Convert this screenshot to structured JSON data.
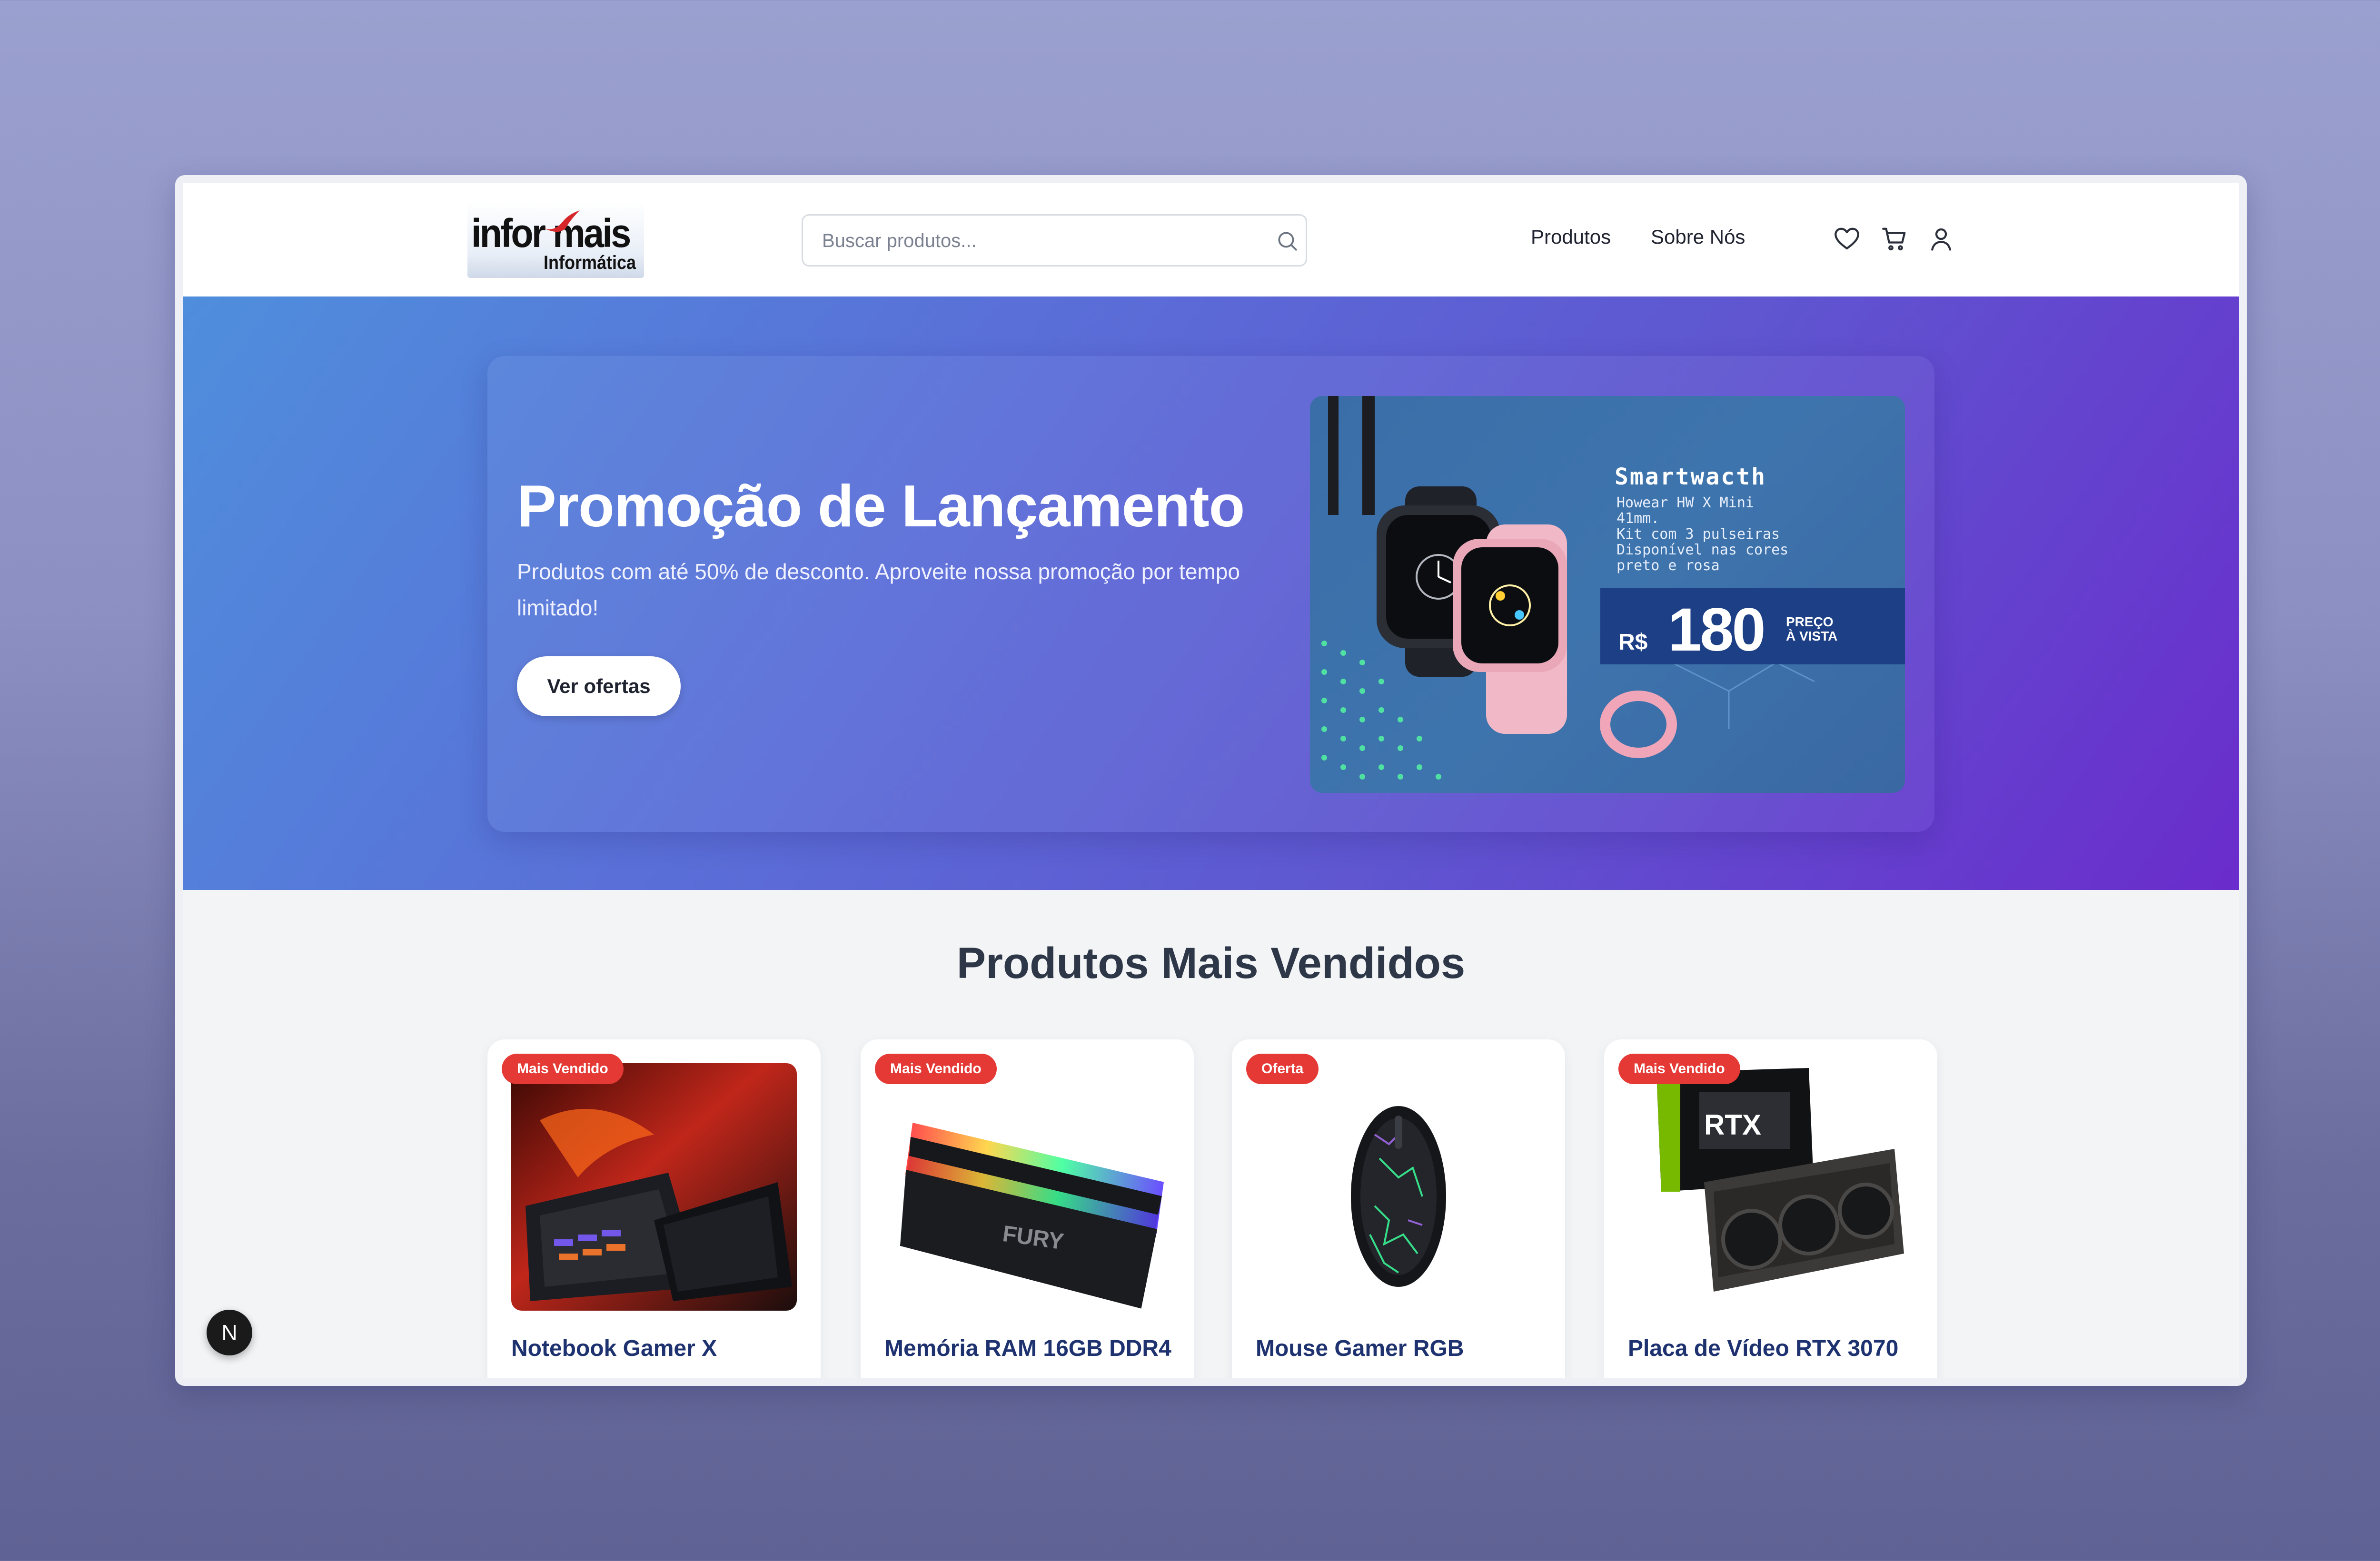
{
  "header": {
    "logo": {
      "main": "infor mais",
      "sub": "Informática"
    },
    "search": {
      "placeholder": "Buscar produtos..."
    },
    "nav": [
      {
        "label": "Produtos"
      },
      {
        "label": "Sobre Nós"
      }
    ],
    "icons": [
      "heart-icon",
      "cart-icon",
      "user-icon"
    ]
  },
  "hero": {
    "title": "Promoção de Lançamento",
    "subtitle": "Produtos com até 50% de desconto. Aproveite nossa promoção por tempo limitado!",
    "cta": "Ver ofertas",
    "banner": {
      "title": "Smartwacth",
      "desc": "Howear HW X Mini\n41mm.\nKit com 3 pulseiras\nDisponível nas cores\npreto e rosa",
      "currency": "R$",
      "price": "180",
      "note": "PREÇO\nÀ VISTA"
    }
  },
  "products": {
    "title": "Produtos Mais Vendidos",
    "items": [
      {
        "badge": "Mais Vendido",
        "name": "Notebook Gamer X"
      },
      {
        "badge": "Mais Vendido",
        "name": "Memória RAM 16GB DDR4"
      },
      {
        "badge": "Oferta",
        "name": "Mouse Gamer RGB"
      },
      {
        "badge": "Mais Vendido",
        "name": "Placa de Vídeo RTX 3070"
      }
    ]
  },
  "devtools": {
    "label": "N"
  },
  "colors": {
    "accent": "#5a6fd8",
    "badge": "#e53935",
    "product_name": "#1e3270"
  }
}
